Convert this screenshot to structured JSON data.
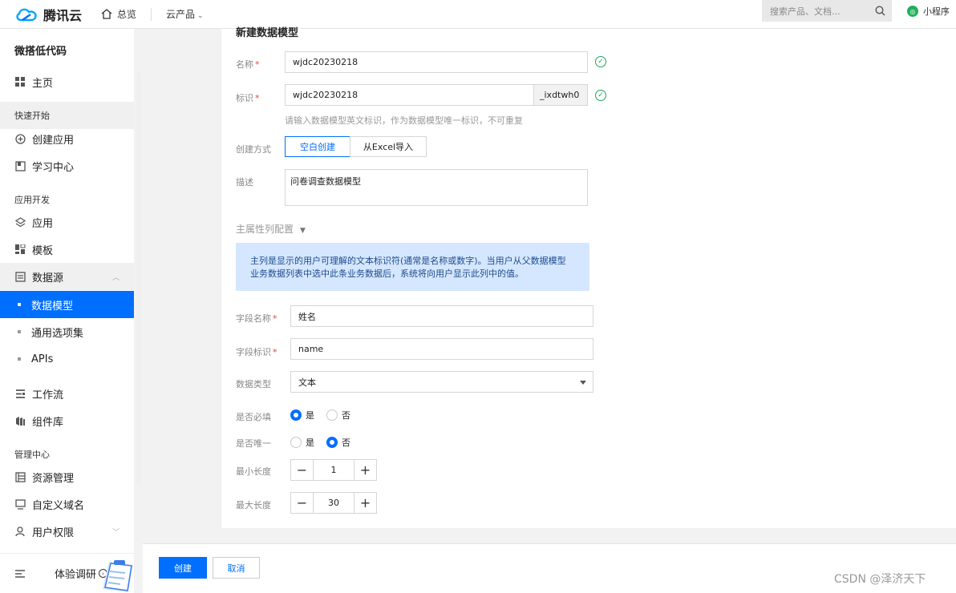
{
  "topbar": {
    "brand": "腾讯云",
    "home": "总览",
    "products": "云产品",
    "search_placeholder": "搜索产品、文档...",
    "mini_program": "小程序"
  },
  "sidebar": {
    "title": "微搭低代码",
    "home": "主页",
    "group_quick": "快速开始",
    "create_app": "创建应用",
    "learn": "学习中心",
    "group_dev": "应用开发",
    "apps": "应用",
    "templates": "模板",
    "datasource": "数据源",
    "data_model": "数据模型",
    "common_options": "通用选项集",
    "apis": "APIs",
    "workflow": "工作流",
    "components": "组件库",
    "group_admin": "管理中心",
    "resources": "资源管理",
    "custom_domain": "自定义域名",
    "user_perms": "用户权限",
    "survey": "体验调研"
  },
  "form": {
    "title": "新建数据模型",
    "name_label": "名称",
    "name_value": "wjdc20230218",
    "id_label": "标识",
    "id_value": "wjdc20230218",
    "id_suffix": "_ixdtwh0",
    "id_hint": "请输入数据模型英文标识，作为数据模型唯一标识，不可重复",
    "method_label": "创建方式",
    "method_blank": "空白创建",
    "method_excel": "从Excel导入",
    "desc_label": "描述",
    "desc_value": "问卷调查数据模型",
    "primary_config": "主属性列配置",
    "info_line1": "主列是显示的用户可理解的文本标识符(通常是名称或数字)。当用户从父数据模型",
    "info_line2": "业务数据列表中选中此条业务数据后，系统将向用户显示此列中的值。",
    "field_name_label": "字段名称",
    "field_name_value": "姓名",
    "field_id_label": "字段标识",
    "field_id_value": "name",
    "data_type_label": "数据类型",
    "data_type_value": "文本",
    "required_label": "是否必填",
    "unique_label": "是否唯一",
    "yes": "是",
    "no": "否",
    "min_len_label": "最小长度",
    "min_len_value": "1",
    "max_len_label": "最大长度",
    "max_len_value": "30"
  },
  "footer": {
    "create": "创建",
    "cancel": "取消"
  },
  "watermark": "CSDN @泽济天下"
}
